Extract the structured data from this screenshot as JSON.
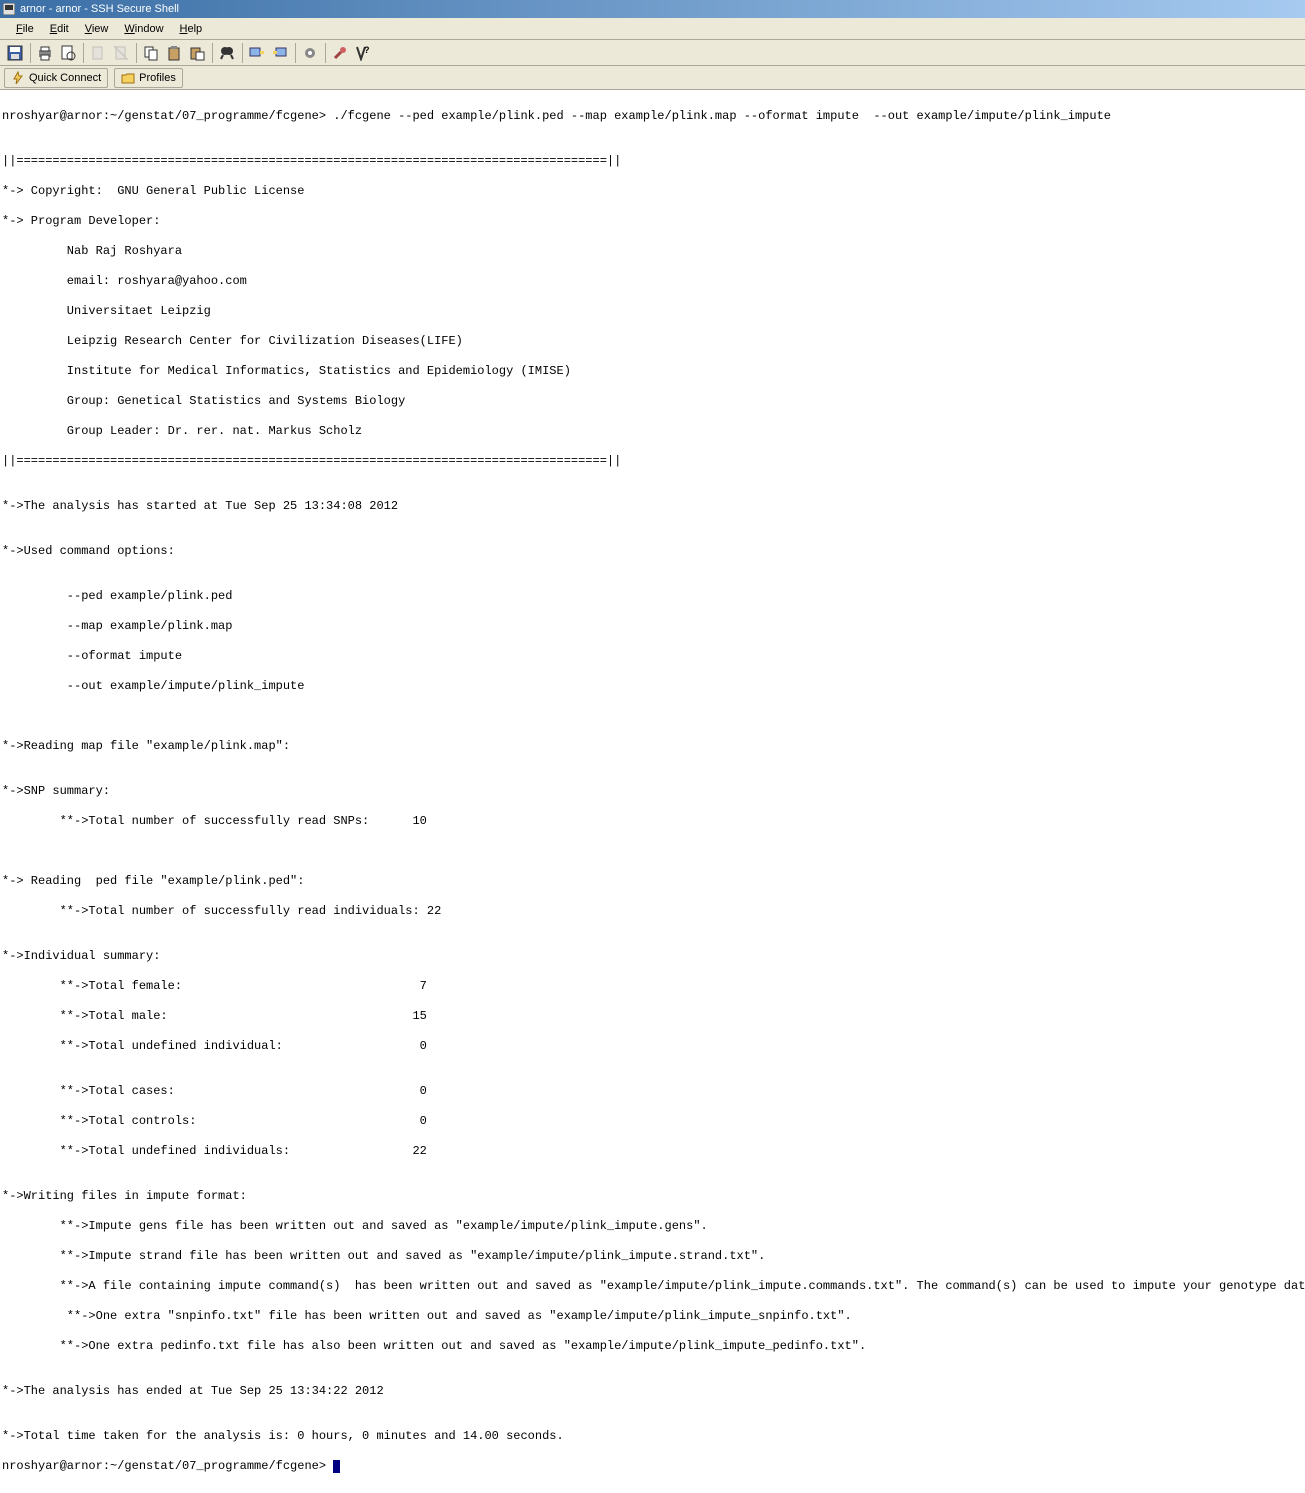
{
  "window": {
    "title": "arnor - arnor - SSH Secure Shell"
  },
  "menu": {
    "file": "File",
    "edit": "Edit",
    "view": "View",
    "window": "Window",
    "help": "Help"
  },
  "quickbar": {
    "quick_connect": "Quick Connect",
    "profiles": "Profiles"
  },
  "icons": {
    "app": "terminal-icon",
    "save": "save-icon",
    "print": "print-icon",
    "preview": "preview-icon",
    "newfolder1": "doc-icon",
    "newfolder2": "doc2-icon",
    "copy": "copy-icon",
    "paste": "paste-icon",
    "paste2": "paste2-icon",
    "find": "find-icon",
    "connect1": "connect-icon",
    "connect2": "connect2-icon",
    "settings": "settings-icon",
    "key": "key-icon",
    "help": "help-icon",
    "lightning": "lightning-icon",
    "folder": "folder-icon"
  },
  "terminal": {
    "prompt1": "nroshyar@arnor:~/genstat/07_programme/fcgene> ./fcgene --ped example/plink.ped --map example/plink.map --oformat impute  --out example/impute/plink_impute",
    "blank": "",
    "sep": "||==================================================================================||",
    "l1": "*-> Copyright:  GNU General Public License",
    "l2": "*-> Program Developer:",
    "l3": "         Nab Raj Roshyara",
    "l4": "         email: roshyara@yahoo.com",
    "l5": "         Universitaet Leipzig",
    "l6": "         Leipzig Research Center for Civilization Diseases(LIFE)",
    "l7": "         Institute for Medical Informatics, Statistics and Epidemiology (IMISE)",
    "l8": "         Group: Genetical Statistics and Systems Biology",
    "l9": "         Group Leader: Dr. rer. nat. Markus Scholz",
    "l10": "*->The analysis has started at Tue Sep 25 13:34:08 2012",
    "l11": "*->Used command options:",
    "l12": "         --ped example/plink.ped",
    "l13": "         --map example/plink.map",
    "l14": "         --oformat impute",
    "l15": "         --out example/impute/plink_impute",
    "l16": "*->Reading map file \"example/plink.map\":",
    "l17": "*->SNP summary:",
    "l18": "        **->Total number of successfully read SNPs:      10",
    "l19": "*-> Reading  ped file \"example/plink.ped\":",
    "l20": "        **->Total number of successfully read individuals: 22",
    "l21": "*->Individual summary:",
    "l22": "        **->Total female:                                 7",
    "l23": "        **->Total male:                                  15",
    "l24": "        **->Total undefined individual:                   0",
    "l25": "        **->Total cases:                                  0",
    "l26": "        **->Total controls:                               0",
    "l27": "        **->Total undefined individuals:                 22",
    "l28": "*->Writing files in impute format:",
    "l29": "        **->Impute gens file has been written out and saved as \"example/impute/plink_impute.gens\".",
    "l30": "        **->Impute strand file has been written out and saved as \"example/impute/plink_impute.strand.txt\".",
    "l31": "        **->A file containing impute command(s)  has been written out and saved as \"example/impute/plink_impute.commands.txt\". The command(s) can be used to impute your genotype data.",
    "l32": "         **->One extra \"snpinfo.txt\" file has been written out and saved as \"example/impute/plink_impute_snpinfo.txt\".",
    "l33": "        **->One extra pedinfo.txt file has also been written out and saved as \"example/impute/plink_impute_pedinfo.txt\".",
    "l34": "*->The analysis has ended at Tue Sep 25 13:34:22 2012",
    "l35": "*->Total time taken for the analysis is: 0 hours, 0 minutes and 14.00 seconds.",
    "prompt2": "nroshyar@arnor:~/genstat/07_programme/fcgene> "
  }
}
